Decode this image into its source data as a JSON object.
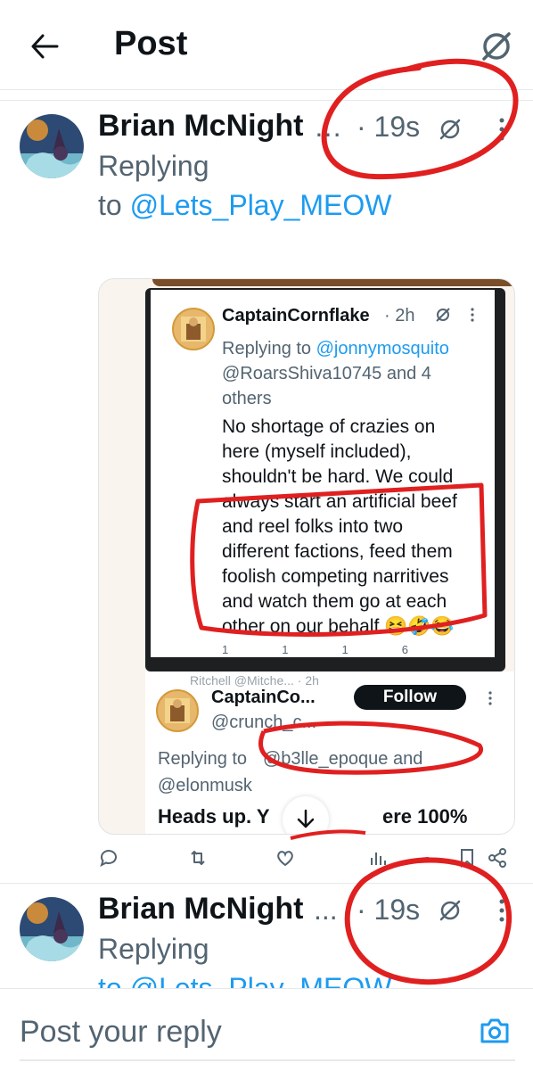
{
  "header": {
    "title": "Post"
  },
  "reply_tweet": {
    "author_name": "Brian McNight",
    "ellipsis": "…",
    "time": "· 19s",
    "replying_prefix": "Replying",
    "replying_to_word": "to",
    "replying_handle": "@Lets_Play_MEOW"
  },
  "embedded_tweet": {
    "author_name": "CaptainCornflake",
    "time": "· 2h",
    "replying_prefix": "Replying to",
    "replying_handle_1": "@jonnymosquito",
    "replying_handle_2": "@RoarsShiva10745 and 4",
    "replying_tail": "others",
    "body_lines": [
      "No shortage of crazies on",
      "here (myself included),",
      "shouldn't be hard. We could",
      "always start an artificial beef",
      "and reel folks into two",
      "different factions, feed them",
      "foolish competing narritives",
      "and watch them go at each",
      "other on our behalf 😆🤣😂"
    ],
    "counts": {
      "reply": "1",
      "retweet": "1",
      "like": "1",
      "views": "6"
    },
    "cut_off_next": "Ritchell @Mitche... · 2h"
  },
  "second_embedded_tweet": {
    "author_name": "CaptainCo...",
    "handle": "@crunch_c...",
    "follow_label": "Follow",
    "replying_prefix": "Replying to",
    "replying_handles": "@b3lle_epoque and",
    "replying_handle_2": "@elonmusk",
    "body_start": "Heads up. Y",
    "body_end": "ere 100%"
  },
  "second_reply_tweet": {
    "author_name": "Brian McNight",
    "ellipsis": "...",
    "time": "· 19s",
    "replying_prefix": "Replying",
    "replying_cut": "to @Lets_Play_MEOW"
  },
  "composer": {
    "placeholder": "Post your reply"
  },
  "colors": {
    "link": "#1d9bf0",
    "annotation_red": "#e02020",
    "muted": "#536471"
  }
}
